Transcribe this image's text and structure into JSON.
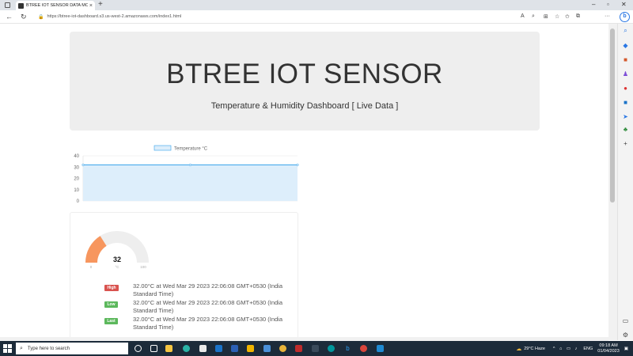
{
  "browser": {
    "tab_title": "BTREE IOT SENSOR DATA MONITOR",
    "url": "https://btree-iot-dashboard.s3.us-west-2.amazonaws.com/index1.html"
  },
  "hero": {
    "title": "BTREE IOT SENSOR",
    "subtitle": "Temperature & Humidity Dashboard [ Live Data ]"
  },
  "chart_data": {
    "type": "area",
    "series": [
      {
        "name": "Temperature °C",
        "values": [
          32,
          32,
          32
        ]
      }
    ],
    "y_ticks": [
      "0",
      "10",
      "20",
      "30",
      "40"
    ],
    "ylim": [
      0,
      40
    ],
    "legend": "top",
    "color": "#36a2eb",
    "fill": "#ddeefb"
  },
  "gauge": {
    "value": 32,
    "value_text": "32",
    "unit": "°C",
    "min_label": "0",
    "max_label": "100",
    "min": 0,
    "max": 100,
    "fill_color": "#f7965e",
    "track_color": "#eeeeee"
  },
  "records": [
    {
      "badge": "High",
      "color": "#d9534f",
      "text": "32.00°C at Wed Mar 29 2023 22:06:08 GMT+0530 (India Standard Time)"
    },
    {
      "badge": "Low",
      "color": "#5cb85c",
      "text": "32.00°C at Wed Mar 29 2023 22:06:08 GMT+0530 (India Standard Time)"
    },
    {
      "badge": "Last",
      "color": "#5cb85c",
      "text": "32.00°C at Wed Mar 29 2023 22:06:08 GMT+0530 (India Standard Time)"
    }
  ],
  "taskbar": {
    "search_placeholder": "Type here to search",
    "weather": "29°C Haze",
    "lang": "ENG",
    "time": "09:18 AM",
    "date": "01/04/2023"
  }
}
